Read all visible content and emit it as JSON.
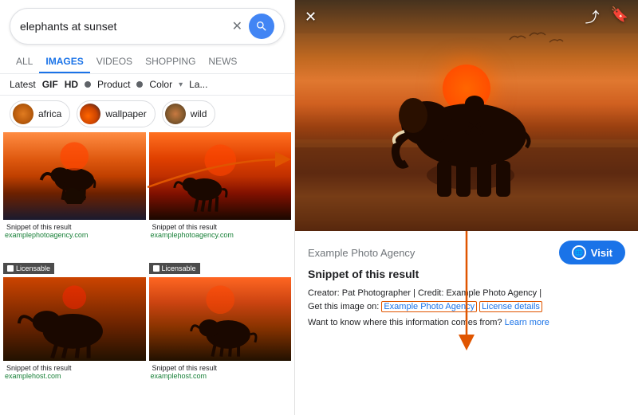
{
  "search": {
    "query": "elephants at sunset",
    "placeholder": "elephants at sunset"
  },
  "nav": {
    "tabs": [
      "ALL",
      "IMAGES",
      "VIDEOS",
      "SHOPPING",
      "NEWS"
    ],
    "active": "IMAGES"
  },
  "filters": {
    "items": [
      "Latest",
      "GIF",
      "HD",
      "Product",
      "Color",
      "La..."
    ]
  },
  "pills": [
    {
      "label": "africa",
      "id": "africa"
    },
    {
      "label": "wallpaper",
      "id": "wallpaper"
    },
    {
      "label": "wild",
      "id": "wild"
    }
  ],
  "grid_items": [
    {
      "badge": "Licensable",
      "snippet": "Snippet of this result",
      "url": "examplephotoagency.com"
    },
    {
      "badge": "Licensable",
      "snippet": "Snippet of this result",
      "url": "examplephotoagency.com"
    },
    {
      "badge": "",
      "snippet": "Snippet of this result",
      "url": "examplehost.com"
    },
    {
      "badge": "",
      "snippet": "Snippet of this result",
      "url": "examplehost.com"
    }
  ],
  "right_panel": {
    "agency": "Example Photo Agency",
    "title": "Snippet of this result",
    "meta": "Creator: Pat Photographer | Credit: Example Photo Agency |",
    "get_image_text": "Get this image on:",
    "agency_link": "Example Photo Agency",
    "license_link": "License details",
    "question": "Want to know where this information comes from?",
    "learn_more": "Learn more",
    "visit_label": "Visit"
  },
  "icons": {
    "close": "✕",
    "share": "⤴",
    "bookmark": "🔖",
    "globe": "🌐",
    "search": "🔍"
  }
}
